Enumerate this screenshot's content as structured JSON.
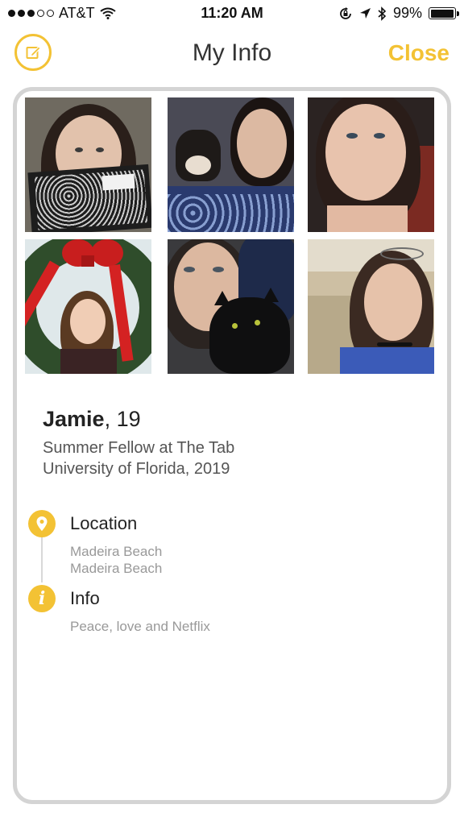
{
  "status_bar": {
    "carrier": "AT&T",
    "time": "11:20 AM",
    "battery_percent": "99%",
    "battery_level": 0.99,
    "signal_bars_filled": 3,
    "signal_bars_total": 5
  },
  "nav": {
    "title": "My Info",
    "close_label": "Close",
    "accent_color": "#f3c234"
  },
  "profile": {
    "name": "Jamie",
    "age_text": ", 19",
    "job": "Summer Fellow at The Tab",
    "school": "University of Florida, 2019",
    "photos": [
      {
        "icon": "photo-notebook"
      },
      {
        "icon": "photo-dog"
      },
      {
        "icon": "photo-closeup"
      },
      {
        "icon": "photo-wreath"
      },
      {
        "icon": "photo-cat"
      },
      {
        "icon": "photo-room"
      }
    ]
  },
  "sections": {
    "location": {
      "title": "Location",
      "line1": "Madeira Beach",
      "line2": "Madeira Beach",
      "icon": "location-pin-icon"
    },
    "info": {
      "title": "Info",
      "text": "Peace, love and Netflix",
      "icon": "info-icon"
    }
  }
}
